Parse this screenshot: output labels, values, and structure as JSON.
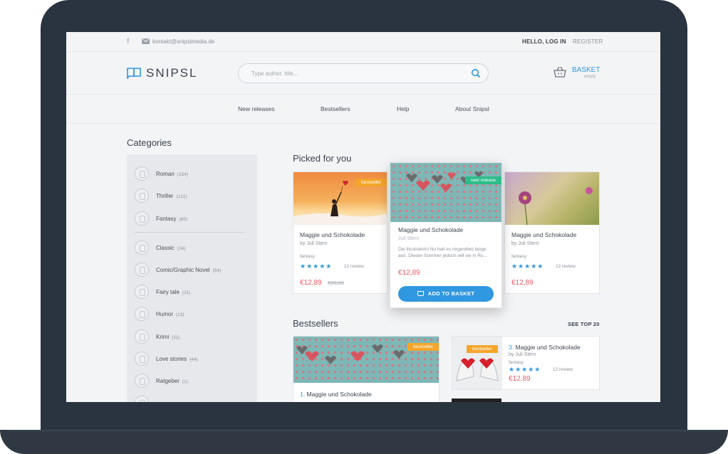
{
  "topbar": {
    "email": "kontakt@snipslmedia.de",
    "login": "HELLO, LOG IN",
    "register": "REGISTER"
  },
  "header": {
    "logo": "SNIPSL",
    "search_placeholder": "Type author, title...",
    "basket_label": "BASKET",
    "basket_status": "empty"
  },
  "nav": [
    "New releases",
    "Bestsellers",
    "Help",
    "About Snipsl"
  ],
  "categories": {
    "title": "Categories",
    "items": [
      {
        "name": "Roman",
        "count": "(154)"
      },
      {
        "name": "Thriller",
        "count": "(121)"
      },
      {
        "name": "Fantasy",
        "count": "(65)"
      },
      {
        "name": "Classic",
        "count": "(24)"
      },
      {
        "name": "Comic/Graphic Novel",
        "count": "(54)"
      },
      {
        "name": "Fairy tale",
        "count": "(21)"
      },
      {
        "name": "Humor",
        "count": "(13)"
      },
      {
        "name": "Krimi",
        "count": "(11)"
      },
      {
        "name": "Love stories",
        "count": "(44)"
      },
      {
        "name": "Ratgeber",
        "count": "(1)"
      }
    ]
  },
  "picked": {
    "title": "Picked for you",
    "cards": [
      {
        "badge": "bestseller",
        "title": "Maggie und Schokolade",
        "author": "by Juli Stern",
        "genre": "fantasy",
        "stars": "★★★★★",
        "reviews": "12 review",
        "price": "€12,89",
        "old_price": "€20,89"
      },
      {
        "badge": "new release",
        "title": "Maggie und Schokolade",
        "author": "Juli Stern",
        "desc": "Die illustratorin Nu halt es nirgendwo lange aus. Diesen Sommer jedoch will sie in Ru...",
        "price": "€12,89",
        "button": "ADD TO BASKET"
      },
      {
        "title": "Maggie und Schokolade",
        "author": "by Juli Stern",
        "genre": "fantasy",
        "stars": "★★★★★",
        "reviews": "12 review",
        "price": "€12,89"
      }
    ]
  },
  "bestsellers": {
    "title": "Bestsellers",
    "see_top": "SEE TOP 20",
    "cards": [
      {
        "badge": "bestseller",
        "rank": "1.",
        "title": "Maggie und Schokolade"
      },
      {
        "badge": "bestseller",
        "rank": "3.",
        "title": "Maggie und Schokolade",
        "author": "by Juli Stern",
        "genre": "fantasy",
        "stars": "★★★★★",
        "reviews": "12 review",
        "price": "€12,89"
      }
    ]
  },
  "colors": {
    "accent": "#2f98e0",
    "price": "#ee5c63",
    "badge": "#f4a52a",
    "new_badge": "#2dbd8a",
    "bezel": "#2a3340"
  }
}
